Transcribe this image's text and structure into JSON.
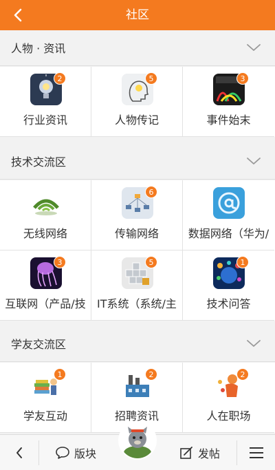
{
  "header": {
    "title": "社区"
  },
  "sections": [
    {
      "title": "人物 · 资讯",
      "items": [
        {
          "name": "行业资讯",
          "badge": "2",
          "icon": "bulb-icon"
        },
        {
          "name": "人物传记",
          "badge": "5",
          "icon": "head-idea-icon"
        },
        {
          "name": "事件始末",
          "badge": "3",
          "icon": "event-icon"
        }
      ]
    },
    {
      "title": "技术交流区",
      "items": [
        {
          "name": "无线网络",
          "badge": "",
          "icon": "wireless-icon"
        },
        {
          "name": "传输网络",
          "badge": "6",
          "icon": "network-icon"
        },
        {
          "name": "数据网络（华为/",
          "badge": "",
          "icon": "at-icon"
        },
        {
          "name": "互联网（产品/技",
          "badge": "3",
          "icon": "jellyfish-icon"
        },
        {
          "name": "IT系统（系统/主",
          "badge": "5",
          "icon": "cubes-icon"
        },
        {
          "name": "技术问答",
          "badge": "1",
          "icon": "apps-icon"
        }
      ]
    },
    {
      "title": "学友交流区",
      "items": [
        {
          "name": "学友互动",
          "badge": "1",
          "icon": "books-icon"
        },
        {
          "name": "招聘资讯",
          "badge": "2",
          "icon": "factory-icon"
        },
        {
          "name": "人在职场",
          "badge": "2",
          "icon": "worker-icon"
        }
      ]
    }
  ],
  "bottom": {
    "forum_label": "版块",
    "post_label": "发帖"
  },
  "colors": {
    "accent": "#f47a1f"
  }
}
